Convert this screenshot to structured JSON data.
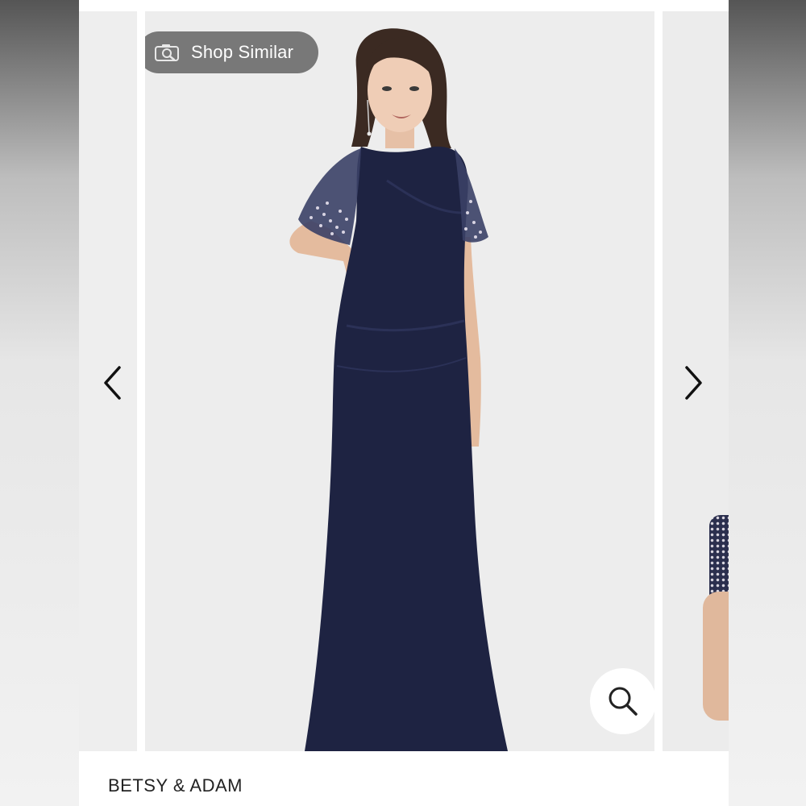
{
  "shop_similar": {
    "label": "Shop Similar",
    "icon": "camera-search-icon"
  },
  "carousel": {
    "prev_icon": "chevron-left-icon",
    "next_icon": "chevron-right-icon",
    "zoom_icon": "magnifier-icon"
  },
  "product": {
    "brand": "BETSY & ADAM"
  },
  "colors": {
    "gown": "#1e2342",
    "background": "#ededed",
    "pill": "#6e6e6e"
  }
}
